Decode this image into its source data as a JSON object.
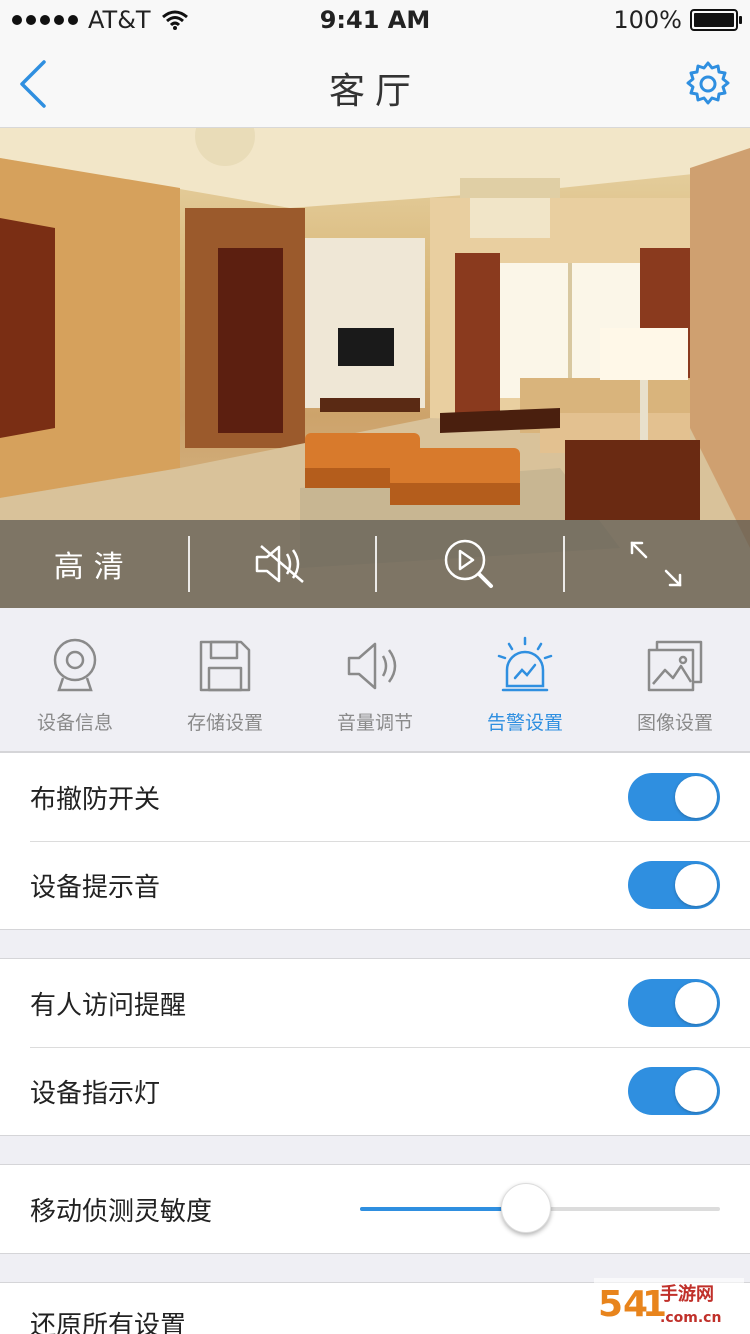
{
  "status_bar": {
    "carrier": "AT&T",
    "time": "9:41 AM",
    "battery": "100%",
    "battery_level": 1.0
  },
  "nav": {
    "title": "客厅",
    "back_icon": "chevron-left-icon",
    "settings_icon": "gear-icon"
  },
  "video_controls": {
    "quality_label": "高清",
    "mute_icon": "speaker-muted-icon",
    "playback_icon": "playback-search-icon",
    "fullscreen_icon": "fullscreen-icon"
  },
  "tabs": [
    {
      "label": "设备信息",
      "icon": "camera-icon",
      "active": false
    },
    {
      "label": "存储设置",
      "icon": "floppy-disk-icon",
      "active": false
    },
    {
      "label": "音量调节",
      "icon": "speaker-icon",
      "active": false
    },
    {
      "label": "告警设置",
      "icon": "alarm-siren-icon",
      "active": true
    },
    {
      "label": "图像设置",
      "icon": "image-icon",
      "active": false
    }
  ],
  "groups": {
    "g1": [
      {
        "label": "布撤防开关",
        "on": true
      },
      {
        "label": "设备提示音",
        "on": true
      }
    ],
    "g2": [
      {
        "label": "有人访问提醒",
        "on": true
      },
      {
        "label": "设备指示灯",
        "on": true
      }
    ],
    "g3": {
      "label": "移动侦测灵敏度",
      "slider_value": 0.46
    },
    "g4": {
      "label": "还原所有设置"
    }
  },
  "colors": {
    "accent": "#2f8fe0",
    "background": "#efeff4"
  }
}
